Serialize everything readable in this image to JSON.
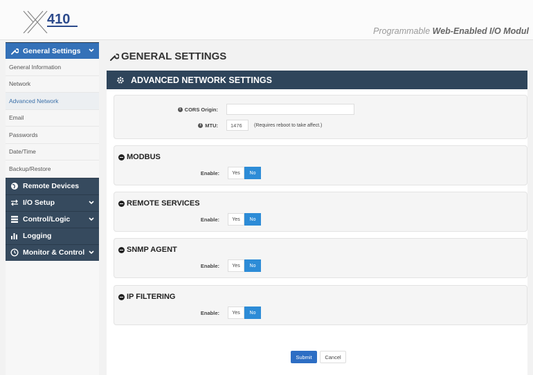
{
  "header": {
    "logo_text": "X410",
    "tagline_light": "Programmable",
    "tagline_strong": "Web-Enabled I/O Modul"
  },
  "sidebar": {
    "sections": [
      {
        "label": "General Settings",
        "icon": "wrench-icon",
        "active": true,
        "has_chevron": true
      },
      {
        "label": "Remote Devices",
        "icon": "globe-icon",
        "active": false,
        "has_chevron": false
      },
      {
        "label": "I/O Setup",
        "icon": "arrows-icon",
        "active": false,
        "has_chevron": true
      },
      {
        "label": "Control/Logic",
        "icon": "list-icon",
        "active": false,
        "has_chevron": true
      },
      {
        "label": "Logging",
        "icon": "bar-chart-icon",
        "active": false,
        "has_chevron": false
      },
      {
        "label": "Monitor & Control",
        "icon": "clock-icon",
        "active": false,
        "has_chevron": true
      }
    ],
    "sub_items": [
      {
        "label": "General Information"
      },
      {
        "label": "Network"
      },
      {
        "label": "Advanced Network",
        "active": true
      },
      {
        "label": "Email"
      },
      {
        "label": "Passwords"
      },
      {
        "label": "Date/Time"
      },
      {
        "label": "Backup/Restore"
      }
    ]
  },
  "main": {
    "page_title": "GENERAL SETTINGS",
    "section_title": "ADVANCED NETWORK SETTINGS",
    "network": {
      "cors_label": "CORS Origin:",
      "cors_value": "",
      "mtu_label": "MTU:",
      "mtu_value": "1476",
      "mtu_hint": "(Requires reboot to take affect.)"
    },
    "panels": [
      {
        "title": "MODBUS",
        "enable_label": "Enable:",
        "yes": "Yes",
        "no": "No",
        "selected": "No"
      },
      {
        "title": "REMOTE SERVICES",
        "enable_label": "Enable:",
        "yes": "Yes",
        "no": "No",
        "selected": "No"
      },
      {
        "title": "SNMP AGENT",
        "enable_label": "Enable:",
        "yes": "Yes",
        "no": "No",
        "selected": "No"
      },
      {
        "title": "IP FILTERING",
        "enable_label": "Enable:",
        "yes": "Yes",
        "no": "No",
        "selected": "No"
      }
    ],
    "submit_label": "Submit",
    "cancel_label": "Cancel"
  },
  "colors": {
    "nav_dark": "#364a5e",
    "nav_active": "#3471b8",
    "section_bar": "#2f455b",
    "toggle_active": "#2d8cd7",
    "submit": "#2d6ec4"
  }
}
